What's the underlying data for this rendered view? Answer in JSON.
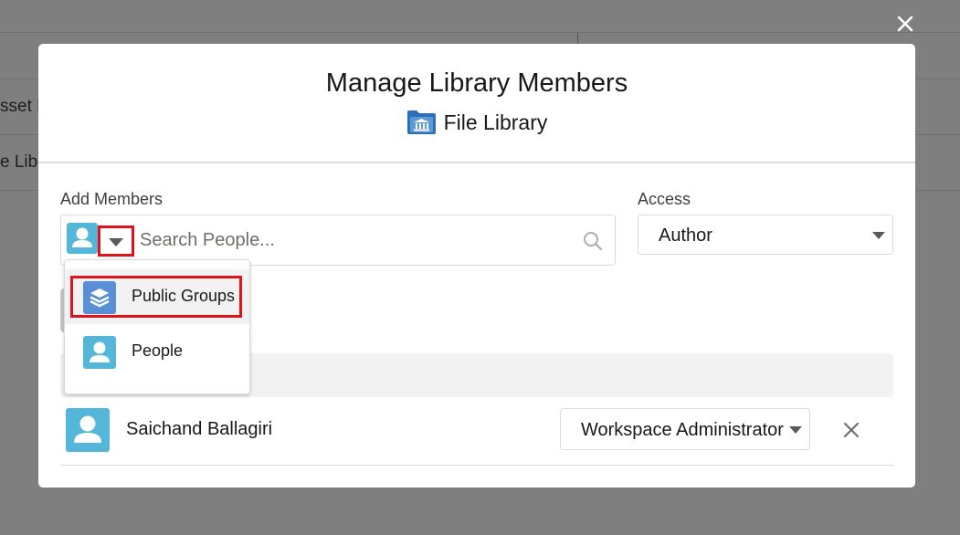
{
  "background": {
    "row1_fragment": "sset L",
    "row2_fragment": "e Lib"
  },
  "modal": {
    "close_glyph": "✕",
    "title": "Manage Library Members",
    "subtitle": "File Library",
    "subtitle_icon": "library-folder-icon"
  },
  "add_members": {
    "label": "Add Members",
    "search_placeholder": "Search People...",
    "search_value": "",
    "type_menu": {
      "items": [
        {
          "label": "Public Groups",
          "icon": "stacked-layers-icon",
          "color": "#5a8fd6",
          "highlighted": true
        },
        {
          "label": "People",
          "icon": "user-icon",
          "color": "#54b7d9",
          "highlighted": false
        }
      ]
    }
  },
  "access": {
    "label": "Access",
    "selected": "Author"
  },
  "members": [
    {
      "name": "Saichand Ballagiri",
      "role": "Workspace Administrator",
      "remove_glyph": "✕"
    }
  ],
  "colors": {
    "highlight_red": "#e0131a",
    "user_avatar": "#54b7d9",
    "group_icon": "#5a8fd6",
    "overlay": "#7f7f7f"
  }
}
